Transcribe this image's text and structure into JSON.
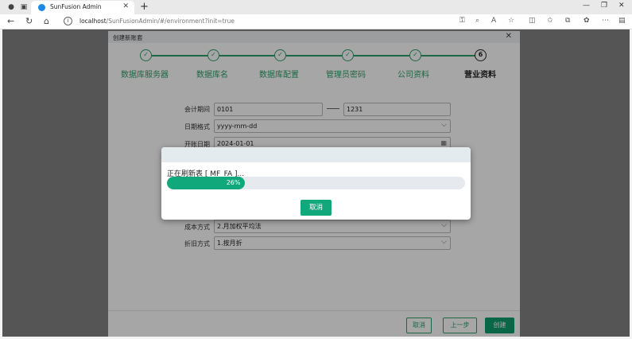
{
  "browser": {
    "tab_title": "SunFusion Admin",
    "url_host": "localhost",
    "url_path": "/SunFusionAdmin/#/environment?init=true"
  },
  "dialog": {
    "title": "创建新账套",
    "close": "✕",
    "steps": [
      {
        "label": "数据库服务器",
        "marker": "✓",
        "state": "done"
      },
      {
        "label": "数据库名",
        "marker": "✓",
        "state": "done"
      },
      {
        "label": "数据库配置",
        "marker": "✓",
        "state": "done"
      },
      {
        "label": "管理员密码",
        "marker": "✓",
        "state": "done"
      },
      {
        "label": "公司资料",
        "marker": "✓",
        "state": "done"
      },
      {
        "label": "营业资料",
        "marker": "6",
        "state": "current"
      }
    ],
    "form": {
      "period_label": "会计期间",
      "period_start": "0101",
      "period_end": "1231",
      "date_format_label": "日期格式",
      "date_format_value": "yyyy-mm-dd",
      "open_date_label": "开账日期",
      "open_date_value": "2024-01-01",
      "cost_method_label": "成本方式",
      "cost_method_value": "2.月加权平均法",
      "depreciation_label": "折旧方式",
      "depreciation_value": "1.按月折"
    },
    "footer": {
      "cancel": "取消",
      "prev": "上一步",
      "create": "创建"
    }
  },
  "progress": {
    "status_text": "正在刷新表 [ MF_FA ]...",
    "percent": 26,
    "percent_text": "26%",
    "cancel": "取消"
  },
  "colors": {
    "accent": "#11a97b",
    "step_green": "#2e9f6b"
  }
}
